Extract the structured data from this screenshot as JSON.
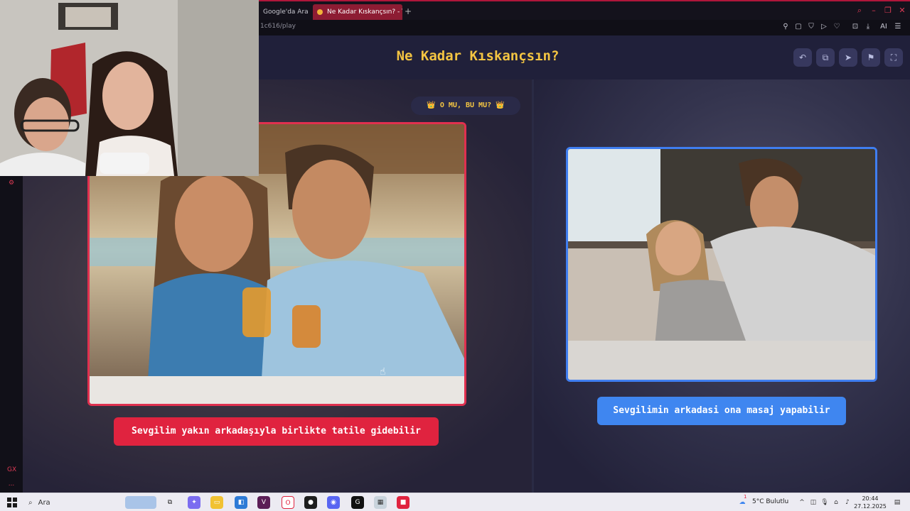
{
  "browser": {
    "tabs": [
      {
        "label": "Google'da Ara",
        "active": false
      },
      {
        "label": "Ne Kadar Kıskançsın? - Ti",
        "active": true
      }
    ],
    "url_fragment": "1c616/play",
    "new_tab_glyph": "+"
  },
  "app": {
    "title": "Ne Kadar Kıskançsın?",
    "mode_badge": "👑 O MU, BU MU? 👑",
    "header_buttons": [
      "undo-icon",
      "share-icon",
      "send-icon",
      "flag-icon",
      "fullscreen-icon"
    ],
    "accent_color": "#f4c542",
    "options": {
      "left": {
        "text": "Sevgilim yakın arkadaşıyla birlikte tatile gidebilir",
        "color": "#e0233f"
      },
      "right": {
        "text": "Sevgilimin arkadasi ona masaj yapabilir",
        "color": "#3f86f0"
      }
    }
  },
  "sidebar": {
    "badge": "GX",
    "more": "..."
  },
  "taskbar": {
    "search_placeholder": "Ara",
    "weather": "5°C Bulutlu",
    "time": "20:44",
    "date": "27.12.2025",
    "weather_badge": "1"
  }
}
